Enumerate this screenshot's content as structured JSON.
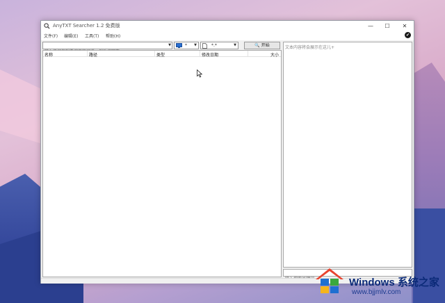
{
  "window": {
    "title": "AnyTXT Searcher 1.2 免费版",
    "controls": {
      "minimize": "—",
      "maximize": "☐",
      "close": "✕"
    }
  },
  "menu": [
    "文件(F)",
    "编辑(E)",
    "工具(T)",
    "帮助(H)"
  ],
  "toolbar": {
    "search_placeholder": "输入任何你想要搜索的词语，然后按回车↵",
    "location_combo": "*",
    "filetype_combo": "*.*",
    "start_label": "开始"
  },
  "columns": [
    "名称",
    "路径",
    "类型",
    "修改日期",
    "大小"
  ],
  "preview": {
    "placeholder": "文本内容将会展示在这儿+",
    "search_placeholder": "输入搜索关键词"
  },
  "watermark": {
    "brand": "Windows 系统之家",
    "url": "www.bjjmlv.com"
  },
  "colors": {
    "window_bg": "#f0f0f0",
    "watermark_blue": "#0b2a78",
    "logo_red": "#e8432f",
    "logo_blue": "#1f6fd1",
    "logo_green": "#3aa83c",
    "logo_yellow": "#f5b51c"
  }
}
